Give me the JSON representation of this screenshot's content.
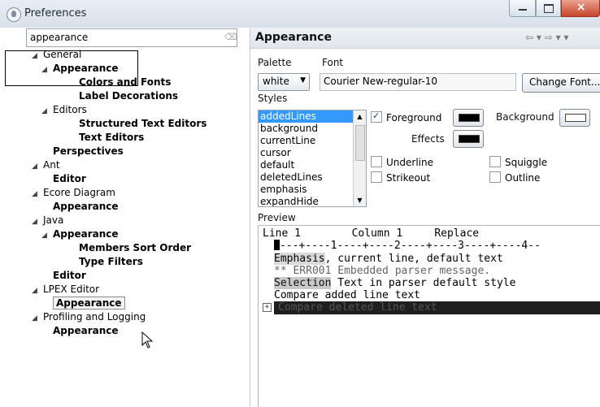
{
  "window": {
    "title": "Preferences",
    "close_glyph": "×"
  },
  "filter": {
    "value": "appearance",
    "clear_icon": "eraser-icon"
  },
  "tree": [
    {
      "label": "General",
      "indent": 0,
      "bold": false,
      "twisty": "◢"
    },
    {
      "label": "Appearance",
      "indent": 1,
      "bold": true,
      "twisty": "◢"
    },
    {
      "label": "Colors and Fonts",
      "indent": 2,
      "bold": true,
      "twisty": ""
    },
    {
      "label": "Label Decorations",
      "indent": 2,
      "bold": true,
      "twisty": ""
    },
    {
      "label": "Editors",
      "indent": 1,
      "bold": false,
      "twisty": "◢"
    },
    {
      "label": "Structured Text Editors",
      "indent": 2,
      "bold": true,
      "twisty": ""
    },
    {
      "label": "Text Editors",
      "indent": 2,
      "bold": true,
      "twisty": ""
    },
    {
      "label": "Perspectives",
      "indent": 1,
      "bold": true,
      "twisty": ""
    },
    {
      "label": "Ant",
      "indent": 0,
      "bold": false,
      "twisty": "◢"
    },
    {
      "label": "Editor",
      "indent": 1,
      "bold": true,
      "twisty": ""
    },
    {
      "label": "Ecore Diagram",
      "indent": 0,
      "bold": false,
      "twisty": "◢"
    },
    {
      "label": "Appearance",
      "indent": 1,
      "bold": true,
      "twisty": ""
    },
    {
      "label": "Java",
      "indent": 0,
      "bold": false,
      "twisty": "◢"
    },
    {
      "label": "Appearance",
      "indent": 1,
      "bold": true,
      "twisty": "◢"
    },
    {
      "label": "Members Sort Order",
      "indent": 2,
      "bold": true,
      "twisty": ""
    },
    {
      "label": "Type Filters",
      "indent": 2,
      "bold": true,
      "twisty": ""
    },
    {
      "label": "Editor",
      "indent": 1,
      "bold": true,
      "twisty": ""
    },
    {
      "label": "LPEX Editor",
      "indent": 0,
      "bold": false,
      "twisty": "◢"
    },
    {
      "label": "Appearance",
      "indent": 1,
      "bold": true,
      "twisty": "",
      "selected": true
    },
    {
      "label": "Profiling and Logging",
      "indent": 0,
      "bold": false,
      "twisty": "◢"
    },
    {
      "label": "Appearance",
      "indent": 1,
      "bold": true,
      "twisty": ""
    }
  ],
  "page": {
    "title": "Appearance",
    "nav": "⇦ ▾ ⇨ ▾ ▾"
  },
  "appearance": {
    "palette_label": "Palette",
    "font_label": "Font",
    "palette_value": "white",
    "font_value": "Courier New-regular-10",
    "change_font_label": "Change Font...",
    "styles_label": "Styles",
    "styles": [
      "addedLines",
      "background",
      "currentLine",
      "cursor",
      "default",
      "deletedLines",
      "emphasis",
      "expandHide"
    ],
    "selected_style": "addedLines",
    "foreground_label": "Foreground",
    "background_label": "Background",
    "effects_label": "Effects",
    "underline_label": "Underline",
    "strikeout_label": "Strikeout",
    "squiggle_label": "Squiggle",
    "outline_label": "Outline",
    "foreground_checked": true,
    "colors": {
      "foreground": "#000000",
      "background": "#ffffff",
      "effects": "#000000"
    }
  },
  "preview": {
    "label": "Preview",
    "line1": "Line 1        Column 1     Replace",
    "ruler": "---+----1----+----2----+----3----+----4--",
    "emphasis_word": "Emphasis",
    "emphasis_rest": ", current line, default text",
    "error_line": "** ERR001 Embedded parser message.",
    "selection_word": "Selection",
    "selection_rest": " Text in parser default style",
    "added_line": "Compare added line text",
    "deleted_line": "Compare deleted line text",
    "expand_glyph": "+"
  }
}
